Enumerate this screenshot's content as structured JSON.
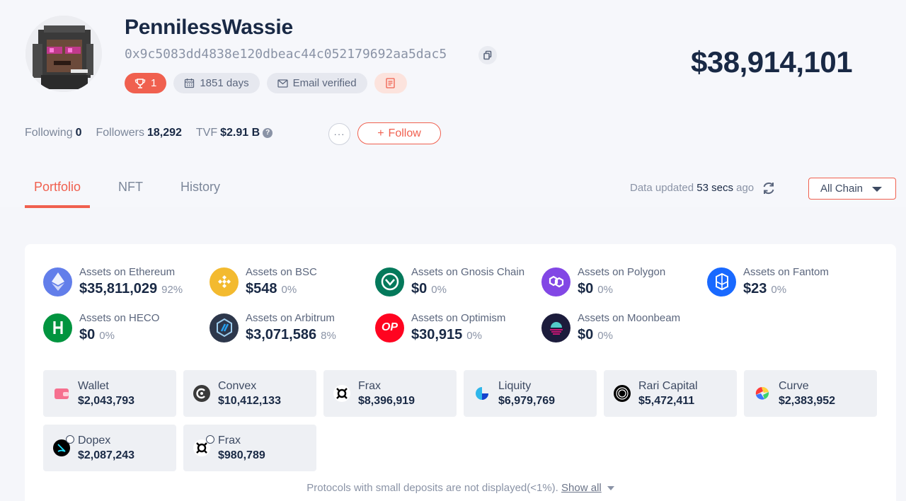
{
  "profile": {
    "username": "PennilessWassie",
    "address": "0x9c5083dd4838e120dbeac44c052179692aa5dac5",
    "total_value": "$38,914,101",
    "badges": {
      "rank": "1",
      "days": "1851 days",
      "email": "Email verified"
    }
  },
  "stats": {
    "following_label": "Following",
    "following_value": "0",
    "followers_label": "Followers",
    "followers_value": "18,292",
    "tvf_label": "TVF",
    "tvf_value": "$2.91 B",
    "help_glyph": "?"
  },
  "actions": {
    "more": "···",
    "follow": "Follow",
    "follow_plus": "+"
  },
  "tabs": [
    {
      "label": "Portfolio",
      "active": true
    },
    {
      "label": "NFT",
      "active": false
    },
    {
      "label": "History",
      "active": false
    }
  ],
  "data_status": {
    "prefix": "Data updated",
    "value": "53 secs",
    "suffix": "ago"
  },
  "chain_filter": {
    "selected": "All Chain"
  },
  "chains": [
    {
      "label": "Assets on Ethereum",
      "value": "$35,811,029",
      "pct": "92%",
      "color": "#627eea",
      "icon": "ethereum-icon"
    },
    {
      "label": "Assets on BSC",
      "value": "$548",
      "pct": "0%",
      "color": "#f3ba2f",
      "icon": "bsc-icon"
    },
    {
      "label": "Assets on Gnosis Chain",
      "value": "$0",
      "pct": "0%",
      "color": "#04795b",
      "icon": "gnosis-icon"
    },
    {
      "label": "Assets on Polygon",
      "value": "$0",
      "pct": "0%",
      "color": "#8247e5",
      "icon": "polygon-icon"
    },
    {
      "label": "Assets on Fantom",
      "value": "$23",
      "pct": "0%",
      "color": "#1969ff",
      "icon": "fantom-icon"
    },
    {
      "label": "Assets on HECO",
      "value": "$0",
      "pct": "0%",
      "color": "#01943f",
      "icon": "heco-icon"
    },
    {
      "label": "Assets on Arbitrum",
      "value": "$3,071,586",
      "pct": "8%",
      "color": "#2d374b",
      "icon": "arbitrum-icon"
    },
    {
      "label": "Assets on Optimism",
      "value": "$30,915",
      "pct": "0%",
      "color": "#ff0420",
      "icon": "optimism-icon",
      "glyph": "OP"
    },
    {
      "label": "Assets on Moonbeam",
      "value": "$0",
      "pct": "0%",
      "color": "#1c1c3c",
      "icon": "moonbeam-icon"
    }
  ],
  "protocols": [
    {
      "name": "Wallet",
      "value": "$2,043,793",
      "icon": "wallet-icon"
    },
    {
      "name": "Convex",
      "value": "$10,412,133",
      "icon": "convex-icon"
    },
    {
      "name": "Frax",
      "value": "$8,396,919",
      "icon": "frax-icon"
    },
    {
      "name": "Liquity",
      "value": "$6,979,769",
      "icon": "liquity-icon"
    },
    {
      "name": "Rari Capital",
      "value": "$5,472,411",
      "icon": "rari-icon"
    },
    {
      "name": "Curve",
      "value": "$2,383,952",
      "icon": "curve-icon"
    },
    {
      "name": "Dopex",
      "value": "$2,087,243",
      "icon": "dopex-icon"
    },
    {
      "name": "Frax",
      "value": "$980,789",
      "icon": "frax-icon"
    }
  ],
  "footer": {
    "note": "Protocols with small deposits are not displayed(<1%).",
    "link": "Show all"
  },
  "colors": {
    "accent": "#f0604f",
    "text_dark": "#192945",
    "text_muted": "#8a93a6"
  }
}
